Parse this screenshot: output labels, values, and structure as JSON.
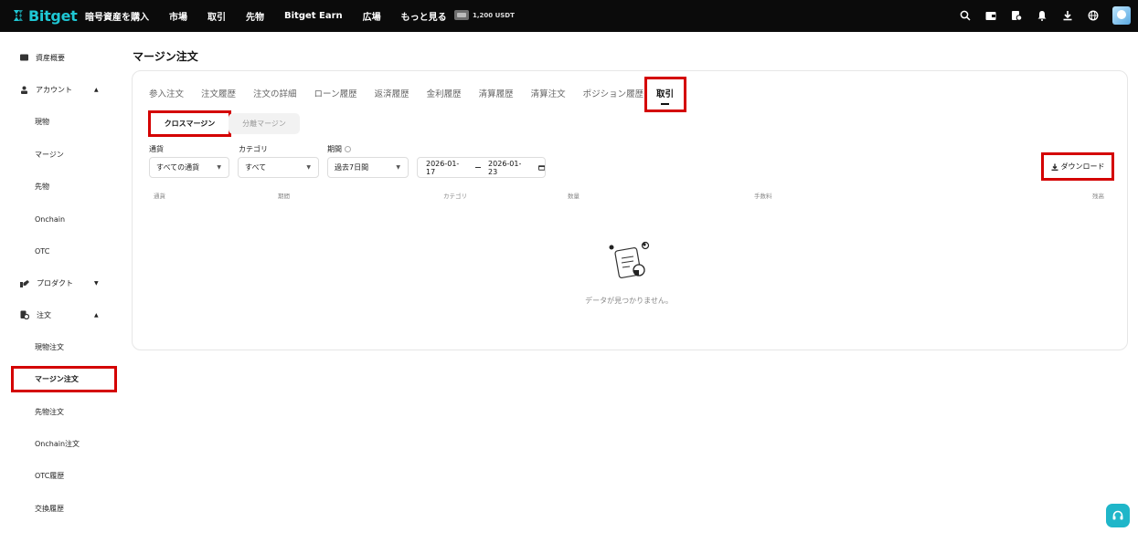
{
  "header": {
    "brand": "Bitget",
    "nav": [
      "暗号資産を購入",
      "市場",
      "取引",
      "先物",
      "Bitget Earn",
      "広場",
      "もっと見る"
    ],
    "promo": "1,200 USDT",
    "icons": [
      "search-icon",
      "wallet-icon",
      "orders-icon",
      "bell-icon",
      "download-icon",
      "globe-icon"
    ]
  },
  "sidebar": {
    "groups": [
      {
        "label": "資産概要",
        "icon": "wallet-icon"
      },
      {
        "label": "アカウント",
        "icon": "user-icon",
        "caret": "▲"
      },
      {
        "label": "プロダクト",
        "icon": "product-icon",
        "caret": "▼"
      },
      {
        "label": "注文",
        "icon": "orders-icon",
        "caret": "▲"
      }
    ],
    "account_items": [
      "現物",
      "マージン",
      "先物",
      "Onchain",
      "OTC"
    ],
    "order_items": [
      "現物注文",
      "マージン注文",
      "先物注文",
      "Onchain注文",
      "OTC履歴",
      "交換履歴"
    ]
  },
  "page": {
    "title": "マージン注文",
    "tabs": [
      "参入注文",
      "注文履歴",
      "注文の詳細",
      "ローン履歴",
      "返済履歴",
      "金利履歴",
      "清算履歴",
      "清算注文",
      "ポジション履歴"
    ],
    "active_tab": "取引",
    "segments": {
      "active": "クロスマージン",
      "other": "分離マージン"
    },
    "filters": {
      "currency_label": "通貨",
      "currency_value": "すべての通貨",
      "category_label": "カテゴリ",
      "category_value": "すべて",
      "period_label": "期間",
      "period_value": "過去7日間",
      "date_start": "2026-01-17",
      "date_end": "2026-01-23"
    },
    "download_label": "ダウンロード",
    "table_headers": [
      "通貨",
      "期間",
      "カテゴリ",
      "数量",
      "手数料",
      "残高"
    ],
    "empty_text": "データが見つかりません。"
  },
  "colors": {
    "brand": "#1fc7d4",
    "highlight": "#d40000",
    "support": "#1fb6c9"
  }
}
